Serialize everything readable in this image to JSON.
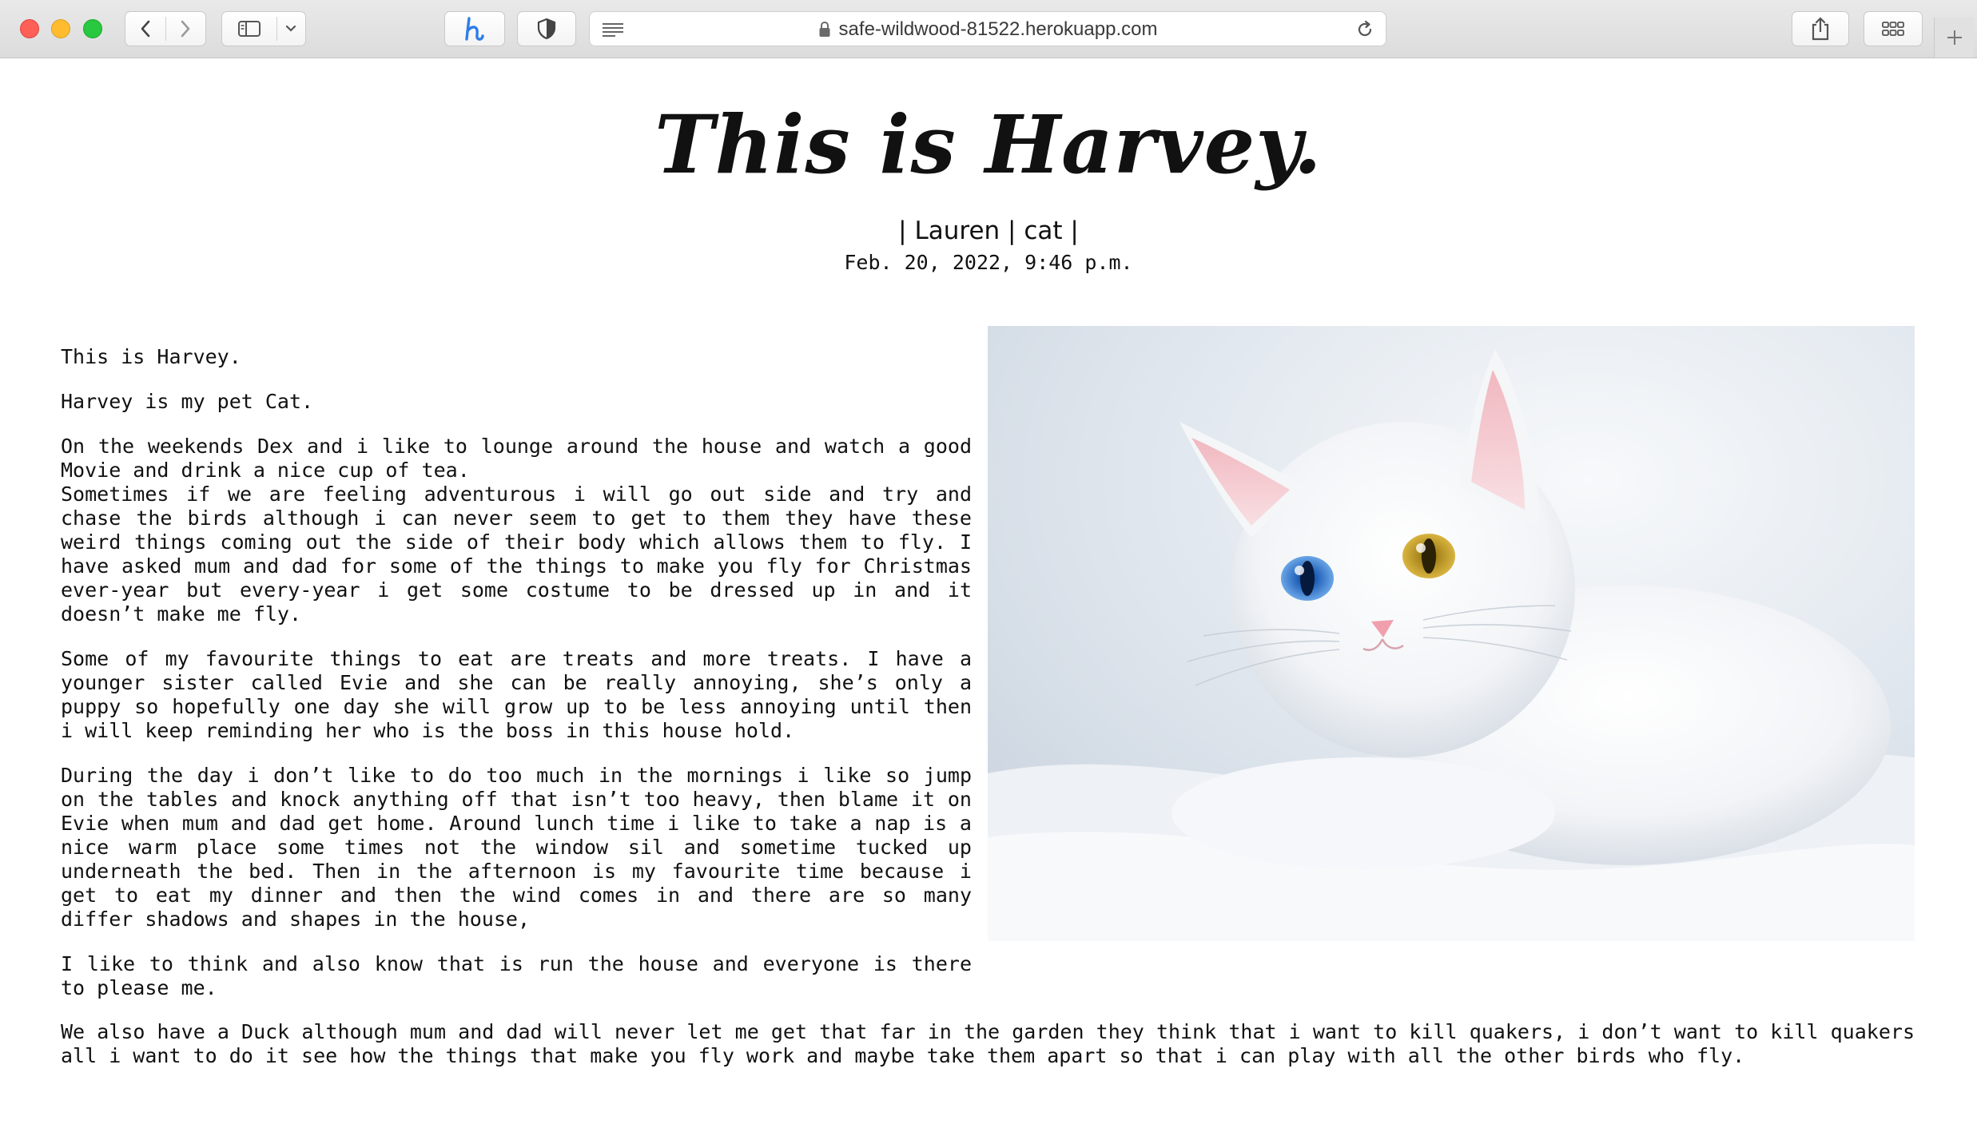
{
  "browser": {
    "url": "safe-wildwood-81522.herokuapp.com"
  },
  "post": {
    "title": "This is Harvey.",
    "byline": "| Lauren | cat |",
    "date": "Feb. 20, 2022, 9:46 p.m.",
    "paragraphs": [
      "This is Harvey.",
      "Harvey is my pet Cat.",
      "On the weekends Dex and i like to lounge around the house and watch a good Movie and drink a nice cup of tea.\n Sometimes if we are feeling adventurous i will go out side and try and chase the birds although i can never seem to get to them they have these weird things coming out the side of their body which allows them to fly. I have asked mum and dad for some of the things to make you fly for Christmas ever-year but every-year i get some costume to be dressed up in and it doesn’t make me fly.",
      "Some of my favourite things to eat are treats and more treats. I have a younger sister called Evie and she can be really annoying, she’s only a puppy so hopefully one day she will grow up to be less annoying until then i will keep reminding her who is the boss in this house hold.",
      "During the day i don’t like to do too much in the mornings i like so jump on the tables and knock anything off that isn’t too heavy, then blame it on Evie when mum and dad get home. Around lunch time i like to take a nap is a nice warm place some times not the window sil and sometime tucked up underneath the bed. Then in the afternoon is my favourite time because i get to eat my dinner and then the wind comes in and there are so many differ shadows and shapes in the house,",
      "I like to think and also know that is run the house and everyone is there to please me."
    ],
    "closing_paragraph": "We also have a Duck although mum and dad will never let me get that far in the garden they think that i want to kill quakers, i don’t want to kill quakers all i want to do it see how the things that make you fly work and maybe take them apart so that i can play with all the other birds who fly."
  }
}
